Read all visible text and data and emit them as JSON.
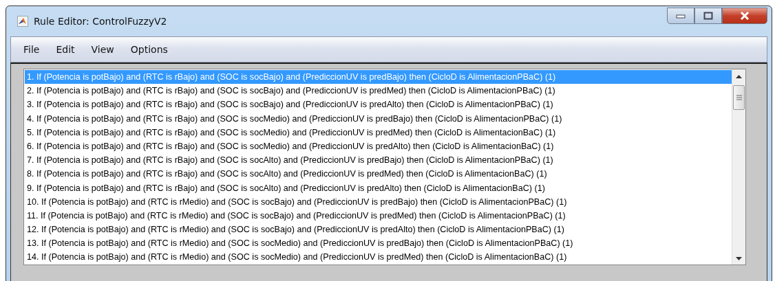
{
  "window": {
    "title": "Rule Editor: ControlFuzzyV2"
  },
  "menu": [
    "File",
    "Edit",
    "View",
    "Options"
  ],
  "rules": [
    {
      "text": "1. If (Potencia is potBajo) and (RTC is rBajo) and (SOC is socBajo) and (PrediccionUV is predBajo) then (CicloD is AlimentacionPBaC) (1)",
      "selected": true
    },
    {
      "text": "2. If (Potencia is potBajo) and (RTC is rBajo) and (SOC is socBajo) and (PrediccionUV is predMed) then (CicloD is AlimentacionPBaC) (1)",
      "selected": false
    },
    {
      "text": "3. If (Potencia is potBajo) and (RTC is rBajo) and (SOC is socBajo) and (PrediccionUV is predAlto) then (CicloD is AlimentacionPBaC) (1)",
      "selected": false
    },
    {
      "text": "4. If (Potencia is potBajo) and (RTC is rBajo) and (SOC is socMedio) and (PrediccionUV is predBajo) then (CicloD is AlimentacionPBaC) (1)",
      "selected": false
    },
    {
      "text": "5. If (Potencia is potBajo) and (RTC is rBajo) and (SOC is socMedio) and (PrediccionUV is predMed) then (CicloD is AlimentacionBaC) (1)",
      "selected": false
    },
    {
      "text": "6. If (Potencia is potBajo) and (RTC is rBajo) and (SOC is socMedio) and (PrediccionUV is predAlto) then (CicloD is AlimentacionBaC) (1)",
      "selected": false
    },
    {
      "text": "7. If (Potencia is potBajo) and (RTC is rBajo) and (SOC is socAlto) and (PrediccionUV is predBajo) then (CicloD is AlimentacionPBaC) (1)",
      "selected": false
    },
    {
      "text": "8. If (Potencia is potBajo) and (RTC is rBajo) and (SOC is socAlto) and (PrediccionUV is predMed) then (CicloD is AlimentacionBaC) (1)",
      "selected": false
    },
    {
      "text": "9. If (Potencia is potBajo) and (RTC is rBajo) and (SOC is socAlto) and (PrediccionUV is predAlto) then (CicloD is AlimentacionBaC) (1)",
      "selected": false
    },
    {
      "text": "10. If (Potencia is potBajo) and (RTC is rMedio) and (SOC is socBajo) and (PrediccionUV is predBajo) then (CicloD is AlimentacionPBaC) (1)",
      "selected": false
    },
    {
      "text": "11. If (Potencia is potBajo) and (RTC is rMedio) and (SOC is socBajo) and (PrediccionUV is predMed) then (CicloD is AlimentacionPBaC) (1)",
      "selected": false
    },
    {
      "text": "12. If (Potencia is potBajo) and (RTC is rMedio) and (SOC is socBajo) and (PrediccionUV is predAlto) then (CicloD is AlimentacionPBaC) (1)",
      "selected": false
    },
    {
      "text": "13. If (Potencia is potBajo) and (RTC is rMedio) and (SOC is socMedio) and (PrediccionUV is predBajo) then (CicloD is AlimentacionPBaC) (1)",
      "selected": false
    },
    {
      "text": "14. If (Potencia is potBajo) and (RTC is rMedio) and (SOC is socMedio) and (PrediccionUV is predMed) then (CicloD is AlimentacionBaC) (1)",
      "selected": false
    }
  ]
}
